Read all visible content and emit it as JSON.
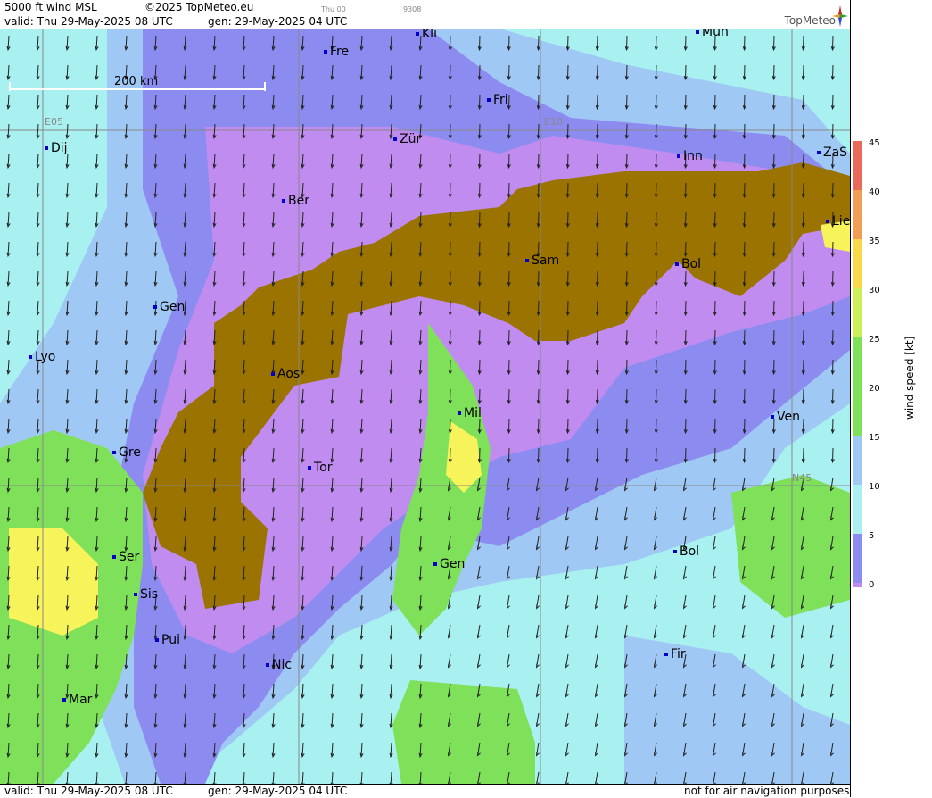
{
  "header": {
    "product": "5000 ft wind MSL",
    "copyright": "©2025 TopMeteo.eu",
    "day_code": "Thu 00",
    "code": "9308",
    "valid": "valid:  Thu  29-May-2025  08 UTC",
    "gen": "gen: 29-May-2025 04 UTC",
    "brand": "TopMeteo"
  },
  "map": {
    "scale_label": "200 km",
    "grid_labels": [
      "E05",
      "E10",
      "N45"
    ],
    "cities": [
      "Kli",
      "Mun",
      "Fre",
      "Fri",
      "Zür",
      "Inn",
      "ZaS",
      "Dij",
      "Ber",
      "Lie",
      "Sam",
      "Bol",
      "Gen",
      "Lyo",
      "Aos",
      "Mil",
      "Ven",
      "Gre",
      "Tor",
      "Ser",
      "Gen",
      "Bol",
      "Sis",
      "Pui",
      "Nic",
      "Fir",
      "Mar"
    ]
  },
  "footer": {
    "valid": "valid:  Thu  29-May-2025  08 UTC",
    "gen": "gen: 29-May-2025 04 UTC",
    "disclaimer": "not for air navigation purposes"
  },
  "legend": {
    "title": "wind speed [kt]",
    "ticks": [
      "45",
      "40",
      "35",
      "30",
      "25",
      "20",
      "15",
      "10",
      "5",
      "0"
    ],
    "colors": [
      "#e86a5a",
      "#f29d55",
      "#f7d94a",
      "#f7f35a",
      "#cdf05a",
      "#7fe05a",
      "#9fd0f0",
      "#a9f0f0",
      "#8c8cf0",
      "#c08cf0"
    ],
    "terrain_color": "#9b7300"
  }
}
